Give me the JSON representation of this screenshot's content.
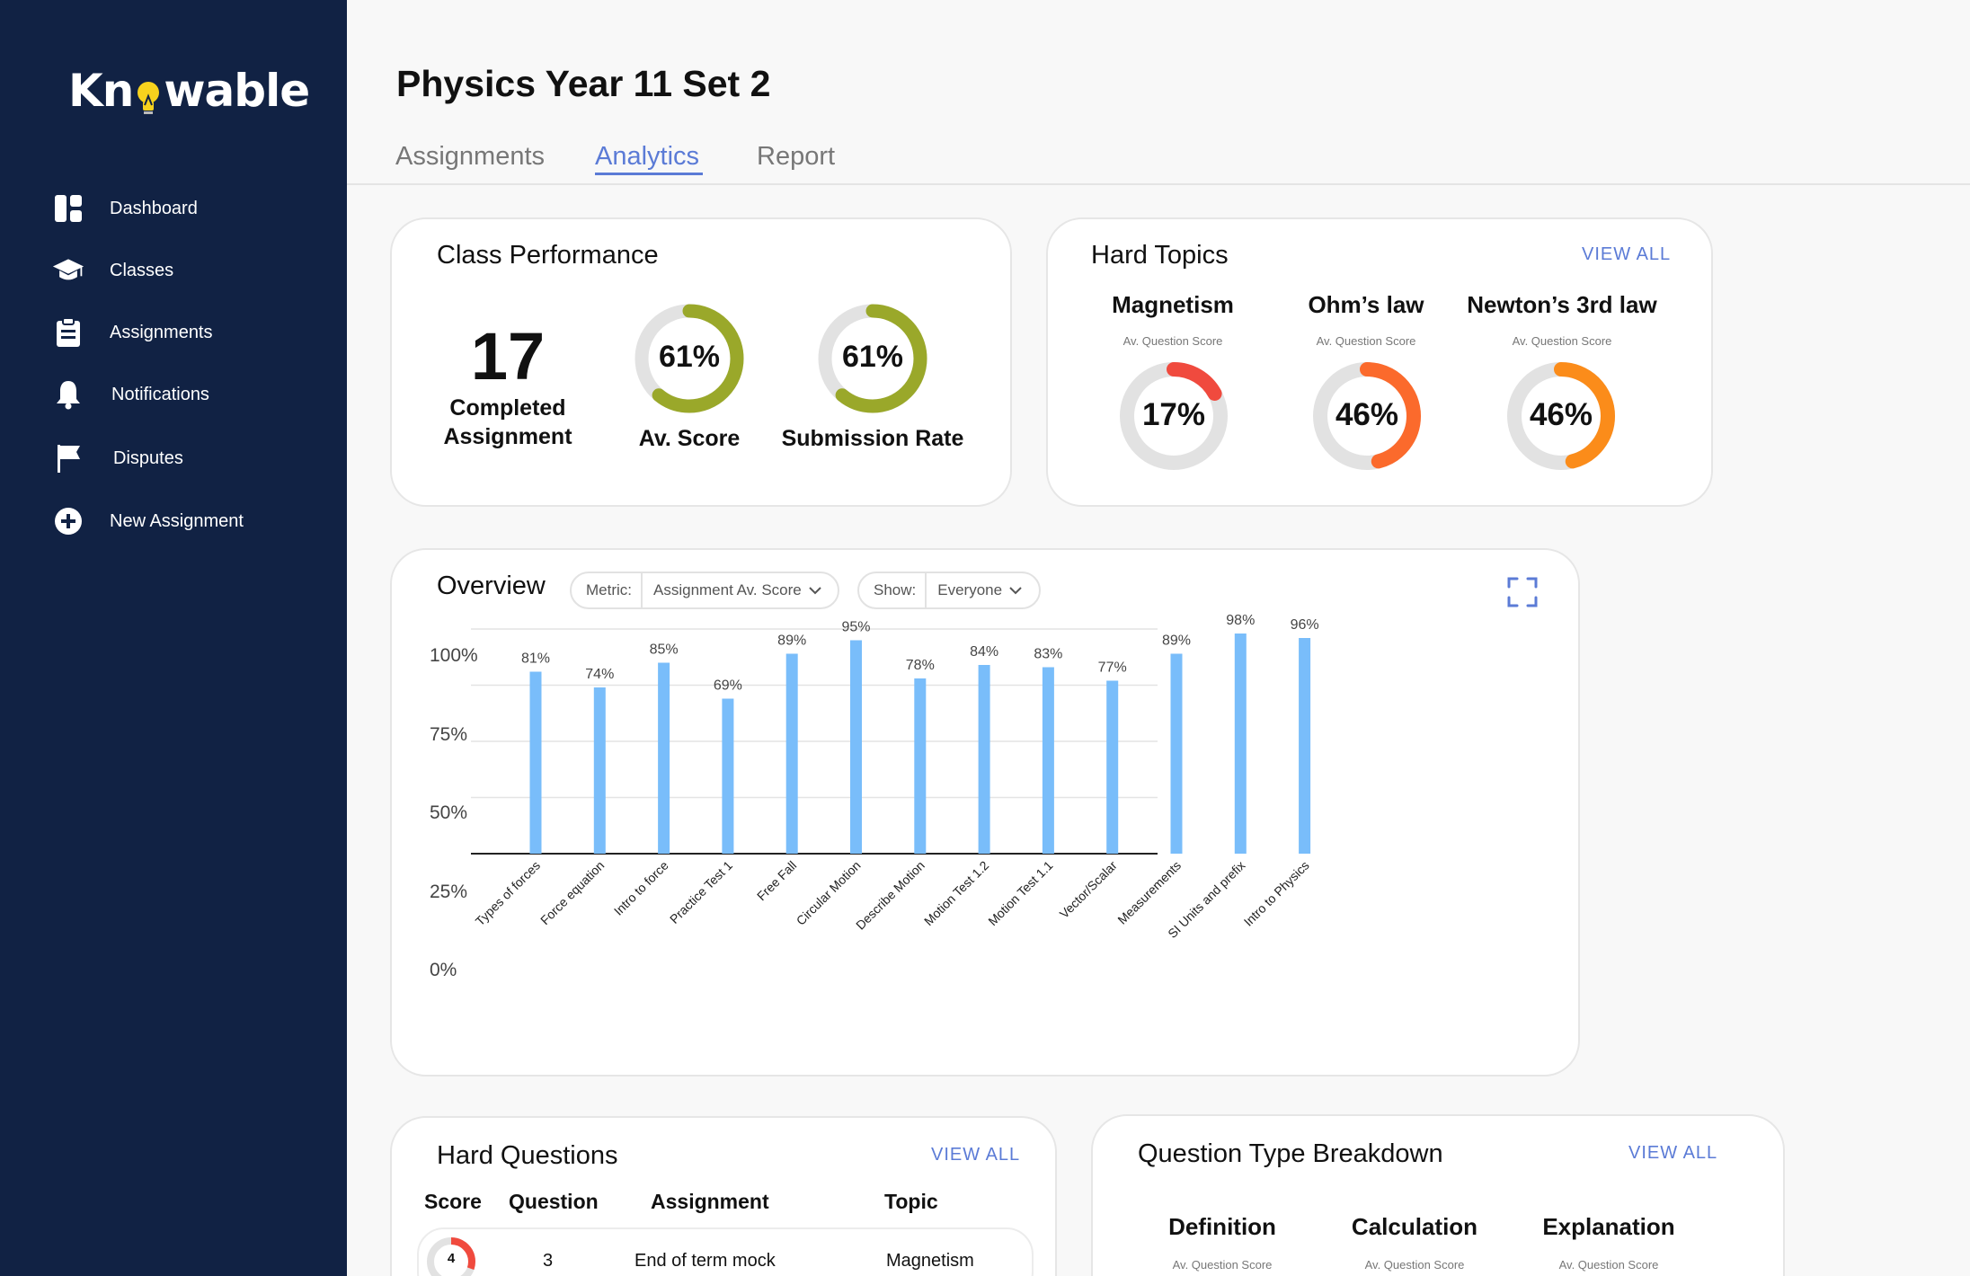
{
  "app": {
    "logo": "Knowable"
  },
  "sidebar": {
    "items": [
      {
        "label": "Dashboard",
        "icon": "dashboard-icon"
      },
      {
        "label": "Classes",
        "icon": "graduation-cap-icon"
      },
      {
        "label": "Assignments",
        "icon": "clipboard-icon"
      },
      {
        "label": "Notifications",
        "icon": "bell-icon"
      },
      {
        "label": "Disputes",
        "icon": "flag-icon"
      },
      {
        "label": "New Assignment",
        "icon": "plus-circle-icon"
      }
    ]
  },
  "header": {
    "title": "Physics Year 11 Set 2",
    "tabs": [
      {
        "label": "Assignments",
        "active": false
      },
      {
        "label": "Analytics",
        "active": true
      },
      {
        "label": "Report",
        "active": false
      }
    ]
  },
  "class_performance": {
    "title": "Class Performance",
    "completed_value": "17",
    "completed_label_1": "Completed",
    "completed_label_2": "Assignment",
    "av_score": {
      "value": 61,
      "text": "61%",
      "label": "Av. Score"
    },
    "submission_rate": {
      "value": 61,
      "text": "61%",
      "label": "Submission Rate"
    },
    "ring_color": "#9aa82a"
  },
  "hard_topics": {
    "title": "Hard Topics",
    "view_all": "VIEW ALL",
    "topics": [
      {
        "name": "Magnetism",
        "caption": "Av. Question Score",
        "value": 17,
        "text": "17%",
        "color": "#f04a3e"
      },
      {
        "name": "Ohm’s law",
        "caption": "Av. Question Score",
        "value": 46,
        "text": "46%",
        "color": "#fb6a2c"
      },
      {
        "name": "Newton’s 3rd law",
        "caption": "Av. Question Score",
        "value": 46,
        "text": "46%",
        "color": "#fb8c1a"
      }
    ]
  },
  "overview": {
    "title": "Overview",
    "metric_key": "Metric:",
    "metric_value": "Assignment Av. Score",
    "show_key": "Show:",
    "show_value": "Everyone"
  },
  "chart_data": {
    "type": "bar",
    "categories": [
      "Types of forces",
      "Force equation",
      "Intro to force",
      "Practice Test 1",
      "Free Fall",
      "Circular Motion",
      "Describe Motion",
      "Motion Test 1.2",
      "Motion Test 1.1",
      "Vector/Scalar",
      "Measurements",
      "SI Units and prefix",
      "Intro to Physics"
    ],
    "values": [
      81,
      74,
      85,
      69,
      89,
      95,
      78,
      84,
      83,
      77,
      89,
      98,
      96
    ],
    "labels": [
      "81%",
      "74%",
      "85%",
      "69%",
      "89%",
      "95%",
      "78%",
      "84%",
      "83%",
      "77%",
      "89%",
      "98%",
      "96%"
    ],
    "yticks": [
      "0%",
      "25%",
      "50%",
      "75%",
      "100%"
    ],
    "ylim": [
      0,
      100
    ],
    "grid": true,
    "bar_color": "#79bdfa"
  },
  "hard_questions": {
    "title": "Hard Questions",
    "view_all": "VIEW ALL",
    "headers": [
      "Score",
      "Question",
      "Assignment",
      "Topic"
    ],
    "rows": [
      {
        "score": "4",
        "question": "3",
        "assignment": "End of term mock",
        "topic": "Magnetism"
      }
    ]
  },
  "question_types": {
    "title": "Question Type Breakdown",
    "view_all": "VIEW ALL",
    "types": [
      {
        "name": "Definition",
        "caption": "Av. Question Score"
      },
      {
        "name": "Calculation",
        "caption": "Av. Question Score"
      },
      {
        "name": "Explanation",
        "caption": "Av. Question Score"
      }
    ]
  }
}
